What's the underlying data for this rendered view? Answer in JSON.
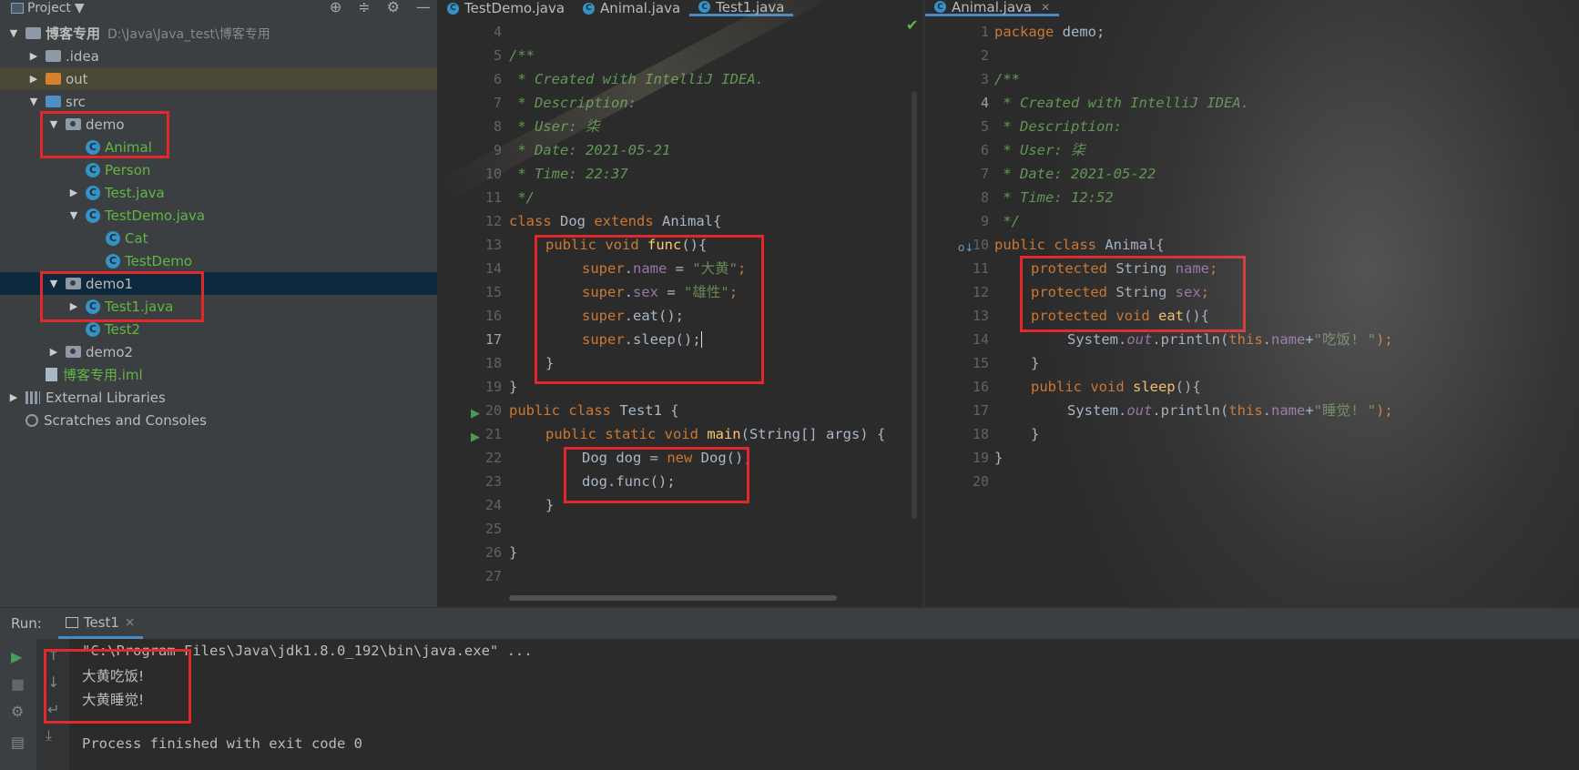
{
  "project": {
    "title": "Project",
    "root_name": "博客专用",
    "root_path": "D:\\Java\\Java_test\\博客专用",
    "tree": [
      {
        "label": ".idea"
      },
      {
        "label": "out"
      },
      {
        "label": "src"
      },
      {
        "label": "demo"
      },
      {
        "label": "Animal"
      },
      {
        "label": "Person"
      },
      {
        "label": "Test.java"
      },
      {
        "label": "TestDemo.java"
      },
      {
        "label": "Cat"
      },
      {
        "label": "TestDemo"
      },
      {
        "label": "demo1"
      },
      {
        "label": "Test1.java"
      },
      {
        "label": "Test2"
      },
      {
        "label": "demo2"
      },
      {
        "label": "博客专用.iml"
      },
      {
        "label": "External Libraries"
      },
      {
        "label": "Scratches and Consoles"
      }
    ]
  },
  "tabs_left": [
    {
      "label": "TestDemo.java"
    },
    {
      "label": "Animal.java"
    },
    {
      "label": "Test1.java"
    }
  ],
  "tabs_right": [
    {
      "label": "Animal.java"
    }
  ],
  "left_editor": {
    "line_numbers": [
      "4",
      "5",
      "6",
      "7",
      "8",
      "9",
      "10",
      "11",
      "12",
      "13",
      "14",
      "15",
      "16",
      "17",
      "18",
      "19",
      "20",
      "21",
      "22",
      "23",
      "24",
      "25",
      "26",
      "27"
    ],
    "code": {
      "l5": "/**",
      "l6": " * Created with IntelliJ IDEA.",
      "l7": " * Description:",
      "l8": " * User: 柒",
      "l9": " * Date: 2021-05-21",
      "l10": " * Time: 22:37",
      "l11": " */",
      "l12_kw": "class",
      "l12_name": " Dog ",
      "l12_kw2": "extends",
      "l12_rest": " Animal{",
      "l13_kw": "public void ",
      "l13_fn": "func",
      "l13_rest": "(){",
      "l14_kw": "super",
      "l14_dot": ".",
      "l14_fld": "name",
      "l14_eq": " = ",
      "l14_str": "\"大黄\"",
      "l14_semi": ";",
      "l15_kw": "super",
      "l15_dot": ".",
      "l15_fld": "sex",
      "l15_eq": " = ",
      "l15_str": "\"雄性\"",
      "l15_semi": ";",
      "l16_kw": "super",
      "l16_rest": ".eat();",
      "l17_kw": "super",
      "l17_rest": ".sleep();",
      "l18": "}",
      "l19": "}",
      "l20_kw": "public class",
      "l20_rest": " Test1 {",
      "l21_kw": "public static void ",
      "l21_fn": "main",
      "l21_rest": "(String[] args) {",
      "l22_a": "Dog dog = ",
      "l22_kw": "new",
      "l22_b": " Dog();",
      "l23": "dog.func();",
      "l24": "}",
      "l26": "}"
    }
  },
  "right_editor": {
    "line_numbers": [
      "1",
      "2",
      "3",
      "4",
      "5",
      "6",
      "7",
      "8",
      "9",
      "10",
      "11",
      "12",
      "13",
      "14",
      "15",
      "16",
      "17",
      "18",
      "19",
      "20"
    ],
    "code": {
      "l1_kw": "package",
      "l1_rest": " demo;",
      "l3": "/**",
      "l4": " * Created with IntelliJ IDEA.",
      "l5": " * Description:",
      "l6": " * User: 柒",
      "l7": " * Date: 2021-05-22",
      "l8": " * Time: 12:52",
      "l9": " */",
      "l10_kw": "public class",
      "l10_rest": " Animal{",
      "l11_kw": "protected",
      "l11_type": " String ",
      "l11_fld": "name",
      "l11_semi": ";",
      "l12_kw": "protected",
      "l12_type": " String ",
      "l12_fld": "sex",
      "l12_semi": ";",
      "l13_kw": "protected void ",
      "l13_fn": "eat",
      "l13_rest": "(){",
      "l14_a": "System.",
      "l14_out": "out",
      "l14_b": ".println(",
      "l14_this": "this",
      "l14_dot": ".",
      "l14_fld": "name",
      "l14_plus": "+",
      "l14_str": "\"吃饭! \"",
      "l14_end": ");",
      "l15": "}",
      "l16_kw": "public void ",
      "l16_fn": "sleep",
      "l16_rest": "(){",
      "l17_a": "System.",
      "l17_out": "out",
      "l17_b": ".println(",
      "l17_this": "this",
      "l17_dot": ".",
      "l17_fld": "name",
      "l17_plus": "+",
      "l17_str": "\"睡觉! \"",
      "l17_end": ");",
      "l18": "}",
      "l19": "}"
    }
  },
  "run": {
    "label": "Run:",
    "tab": "Test1",
    "tab_close": "×",
    "lines": [
      "\"C:\\Program Files\\Java\\jdk1.8.0_192\\bin\\java.exe\" ...",
      "大黄吃饭!",
      "大黄睡觉!",
      "",
      "Process finished with exit code 0"
    ]
  },
  "colors": {
    "highlight_box": "#e3282c",
    "keyword": "#cc7832",
    "comment": "#629755",
    "string": "#6a8759",
    "field": "#9876aa",
    "function": "#ffc66d"
  }
}
